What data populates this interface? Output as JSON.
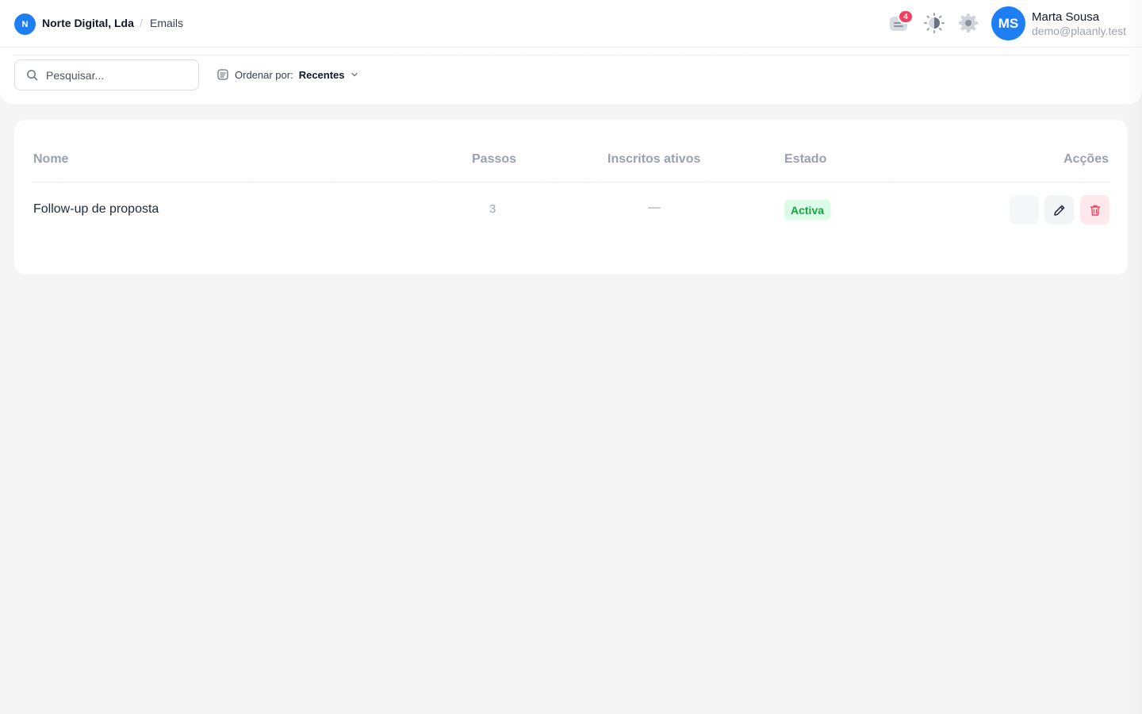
{
  "header": {
    "org_initial": "N",
    "org_name": "Norte Digital, Lda",
    "breadcrumb_separator": "/",
    "page": "Emails",
    "notifications_count": "4",
    "user": {
      "initials": "MS",
      "name": "Marta Sousa",
      "email": "demo@plaanly.test"
    }
  },
  "toolbar": {
    "search_placeholder": "Pesquisar...",
    "search_value": "",
    "sort_label": "Ordenar por:",
    "sort_value": "Recentes"
  },
  "table": {
    "columns": [
      "Nome",
      "Passos",
      "Inscritos ativos",
      "Estado",
      "Acções"
    ],
    "rows": [
      {
        "name": "Follow-up de proposta",
        "steps": "3",
        "active_subscribers": "—",
        "status": "Activa"
      }
    ]
  },
  "icons": {
    "notifications": "notification-icon",
    "theme": "theme-toggle-icon",
    "settings": "gear-icon",
    "search": "search-icon",
    "sort": "sort-icon",
    "edit": "pencil-icon",
    "delete": "trash-icon"
  },
  "colors": {
    "accent": "#1e7ff5",
    "badge": "#f43f5e",
    "status_active_bg": "#dcfce7",
    "status_active_text": "#16a34a",
    "delete_bg": "#fde8ec",
    "delete_icon": "#f43f5e"
  }
}
